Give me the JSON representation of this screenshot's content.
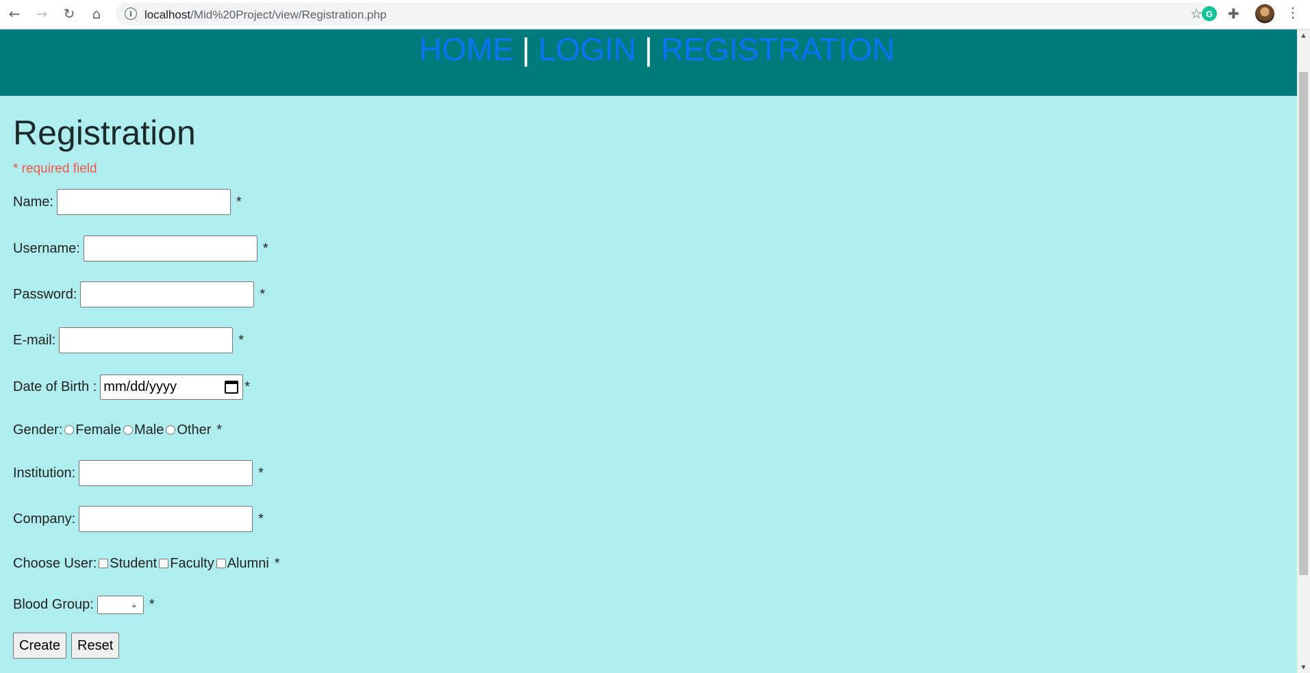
{
  "browser": {
    "url_host": "localhost",
    "url_path": "/Mid%20Project/view/Registration.php",
    "icons": {
      "back": "back-arrow-icon",
      "forward": "forward-arrow-icon",
      "reload": "reload-icon",
      "home": "home-icon",
      "info": "info-icon",
      "bookmark": "star-icon",
      "extension_g": "grammarly-icon",
      "extensions": "puzzle-icon",
      "menu": "kebab-menu-icon"
    },
    "extension_letter": "G"
  },
  "nav": {
    "home": "HOME",
    "login": "LOGIN",
    "registration": "REGISTRATION",
    "separator": "|"
  },
  "form": {
    "title": "Registration",
    "required_note": "* required field",
    "star": "*",
    "name_label": "Name:",
    "username_label": "Username:",
    "password_label": "Password:",
    "email_label": "E-mail:",
    "dob_label": "Date of Birth :",
    "dob_placeholder": "mm/dd/yyyy",
    "gender_label": "Gender:",
    "gender_options": [
      "Female",
      "Male",
      "Other"
    ],
    "institution_label": "Institution:",
    "company_label": "Company:",
    "user_label": "Choose User:",
    "user_options": [
      "Student",
      "Faculty",
      "Alumni"
    ],
    "blood_label": "Blood Group:",
    "blood_selected": "",
    "create_button": "Create",
    "reset_button": "Reset"
  },
  "colors": {
    "page_bg": "#afedee",
    "header_bg": "#007b7d",
    "link": "#0a74f5",
    "required": "#f2574a"
  }
}
